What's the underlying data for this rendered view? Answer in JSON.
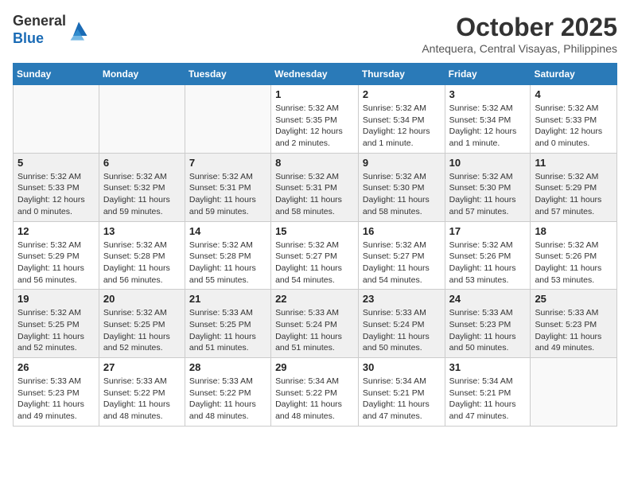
{
  "logo": {
    "general": "General",
    "blue": "Blue"
  },
  "header": {
    "month": "October 2025",
    "location": "Antequera, Central Visayas, Philippines"
  },
  "weekdays": [
    "Sunday",
    "Monday",
    "Tuesday",
    "Wednesday",
    "Thursday",
    "Friday",
    "Saturday"
  ],
  "weeks": [
    [
      {
        "date": "",
        "info": ""
      },
      {
        "date": "",
        "info": ""
      },
      {
        "date": "",
        "info": ""
      },
      {
        "date": "1",
        "info": "Sunrise: 5:32 AM\nSunset: 5:35 PM\nDaylight: 12 hours and 2 minutes."
      },
      {
        "date": "2",
        "info": "Sunrise: 5:32 AM\nSunset: 5:34 PM\nDaylight: 12 hours and 1 minute."
      },
      {
        "date": "3",
        "info": "Sunrise: 5:32 AM\nSunset: 5:34 PM\nDaylight: 12 hours and 1 minute."
      },
      {
        "date": "4",
        "info": "Sunrise: 5:32 AM\nSunset: 5:33 PM\nDaylight: 12 hours and 0 minutes."
      }
    ],
    [
      {
        "date": "5",
        "info": "Sunrise: 5:32 AM\nSunset: 5:33 PM\nDaylight: 12 hours and 0 minutes."
      },
      {
        "date": "6",
        "info": "Sunrise: 5:32 AM\nSunset: 5:32 PM\nDaylight: 11 hours and 59 minutes."
      },
      {
        "date": "7",
        "info": "Sunrise: 5:32 AM\nSunset: 5:31 PM\nDaylight: 11 hours and 59 minutes."
      },
      {
        "date": "8",
        "info": "Sunrise: 5:32 AM\nSunset: 5:31 PM\nDaylight: 11 hours and 58 minutes."
      },
      {
        "date": "9",
        "info": "Sunrise: 5:32 AM\nSunset: 5:30 PM\nDaylight: 11 hours and 58 minutes."
      },
      {
        "date": "10",
        "info": "Sunrise: 5:32 AM\nSunset: 5:30 PM\nDaylight: 11 hours and 57 minutes."
      },
      {
        "date": "11",
        "info": "Sunrise: 5:32 AM\nSunset: 5:29 PM\nDaylight: 11 hours and 57 minutes."
      }
    ],
    [
      {
        "date": "12",
        "info": "Sunrise: 5:32 AM\nSunset: 5:29 PM\nDaylight: 11 hours and 56 minutes."
      },
      {
        "date": "13",
        "info": "Sunrise: 5:32 AM\nSunset: 5:28 PM\nDaylight: 11 hours and 56 minutes."
      },
      {
        "date": "14",
        "info": "Sunrise: 5:32 AM\nSunset: 5:28 PM\nDaylight: 11 hours and 55 minutes."
      },
      {
        "date": "15",
        "info": "Sunrise: 5:32 AM\nSunset: 5:27 PM\nDaylight: 11 hours and 54 minutes."
      },
      {
        "date": "16",
        "info": "Sunrise: 5:32 AM\nSunset: 5:27 PM\nDaylight: 11 hours and 54 minutes."
      },
      {
        "date": "17",
        "info": "Sunrise: 5:32 AM\nSunset: 5:26 PM\nDaylight: 11 hours and 53 minutes."
      },
      {
        "date": "18",
        "info": "Sunrise: 5:32 AM\nSunset: 5:26 PM\nDaylight: 11 hours and 53 minutes."
      }
    ],
    [
      {
        "date": "19",
        "info": "Sunrise: 5:32 AM\nSunset: 5:25 PM\nDaylight: 11 hours and 52 minutes."
      },
      {
        "date": "20",
        "info": "Sunrise: 5:32 AM\nSunset: 5:25 PM\nDaylight: 11 hours and 52 minutes."
      },
      {
        "date": "21",
        "info": "Sunrise: 5:33 AM\nSunset: 5:25 PM\nDaylight: 11 hours and 51 minutes."
      },
      {
        "date": "22",
        "info": "Sunrise: 5:33 AM\nSunset: 5:24 PM\nDaylight: 11 hours and 51 minutes."
      },
      {
        "date": "23",
        "info": "Sunrise: 5:33 AM\nSunset: 5:24 PM\nDaylight: 11 hours and 50 minutes."
      },
      {
        "date": "24",
        "info": "Sunrise: 5:33 AM\nSunset: 5:23 PM\nDaylight: 11 hours and 50 minutes."
      },
      {
        "date": "25",
        "info": "Sunrise: 5:33 AM\nSunset: 5:23 PM\nDaylight: 11 hours and 49 minutes."
      }
    ],
    [
      {
        "date": "26",
        "info": "Sunrise: 5:33 AM\nSunset: 5:23 PM\nDaylight: 11 hours and 49 minutes."
      },
      {
        "date": "27",
        "info": "Sunrise: 5:33 AM\nSunset: 5:22 PM\nDaylight: 11 hours and 48 minutes."
      },
      {
        "date": "28",
        "info": "Sunrise: 5:33 AM\nSunset: 5:22 PM\nDaylight: 11 hours and 48 minutes."
      },
      {
        "date": "29",
        "info": "Sunrise: 5:34 AM\nSunset: 5:22 PM\nDaylight: 11 hours and 48 minutes."
      },
      {
        "date": "30",
        "info": "Sunrise: 5:34 AM\nSunset: 5:21 PM\nDaylight: 11 hours and 47 minutes."
      },
      {
        "date": "31",
        "info": "Sunrise: 5:34 AM\nSunset: 5:21 PM\nDaylight: 11 hours and 47 minutes."
      },
      {
        "date": "",
        "info": ""
      }
    ]
  ]
}
